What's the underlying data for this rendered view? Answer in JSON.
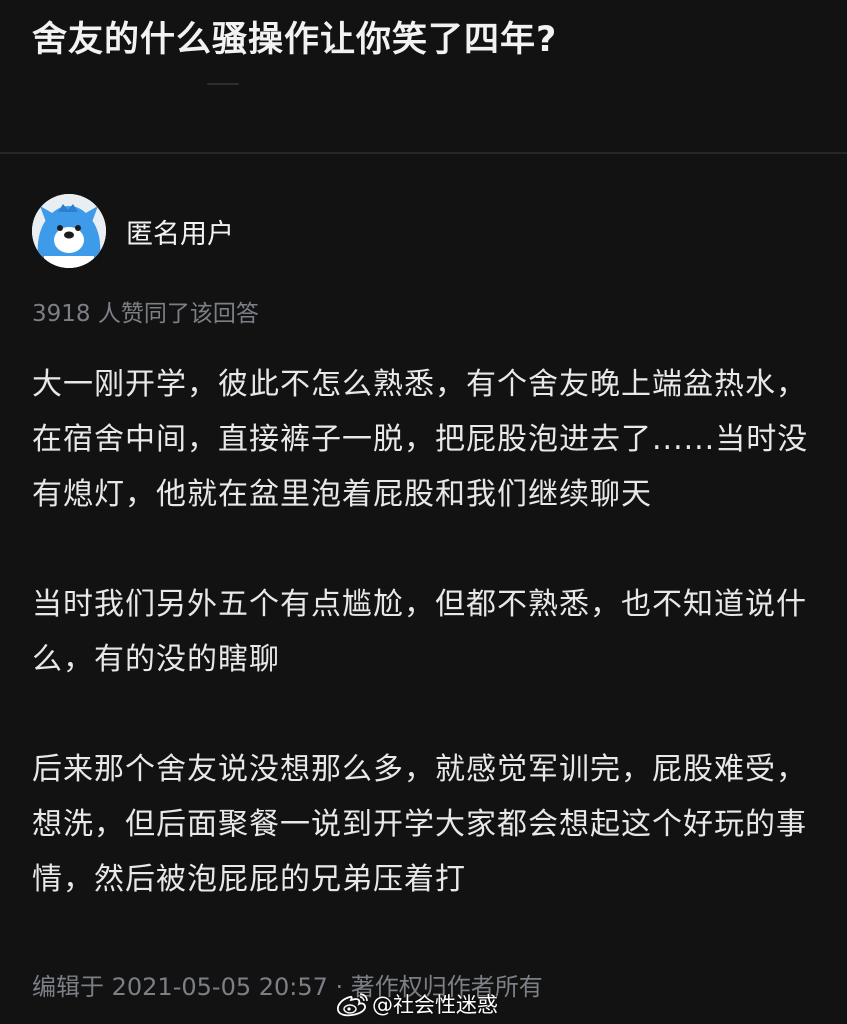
{
  "question": {
    "title": "舍友的什么骚操作让你笑了四年?"
  },
  "author": {
    "name": "匿名用户",
    "avatar_icon": "anonymous-mascot-icon"
  },
  "answer": {
    "vote_text": "3918 人赞同了该回答",
    "paragraphs": [
      "大一刚开学，彼此不怎么熟悉，有个舍友晚上端盆热水，在宿舍中间，直接裤子一脱，把屁股泡进去了......当时没有熄灯，他就在盆里泡着屁股和我们继续聊天",
      "当时我们另外五个有点尴尬，但都不熟悉，也不知道说什么，有的没的瞎聊",
      "后来那个舍友说没想那么多，就感觉军训完，屁股难受，想洗，但后面聚餐一说到开学大家都会想起这个好玩的事情，然后被泡屁屁的兄弟压着打"
    ],
    "edit_meta": "编辑于 2021-05-05 20:57 · 著作权归作者所有"
  },
  "watermark": {
    "text": "@社会性迷惑",
    "icon": "weibo-icon"
  },
  "colors": {
    "background": "#121212",
    "text_primary": "#e8e8e8",
    "text_secondary": "#7c7f86",
    "avatar_blue": "#3d9be9"
  }
}
